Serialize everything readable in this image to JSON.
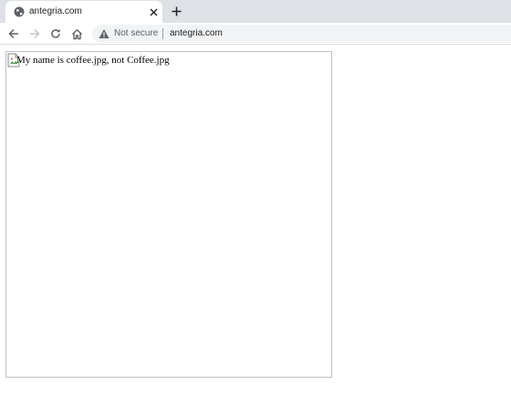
{
  "browser": {
    "tab": {
      "title": "antegria.com",
      "favicon": "globe-icon",
      "close_icon": "close-icon"
    },
    "new_tab_icon": "plus-icon",
    "toolbar": {
      "back_icon": "arrow-left-icon",
      "forward_icon": "arrow-right-icon",
      "reload_icon": "reload-icon",
      "home_icon": "home-icon"
    },
    "omnibox": {
      "security_icon": "warning-icon",
      "security_label": "Not secure",
      "url": "antegria.com"
    }
  },
  "page": {
    "image": {
      "alt": "My name is coffee.jpg, not Coffee.jpg",
      "state": "broken",
      "icon": "broken-image-icon"
    }
  },
  "colors": {
    "tabstrip_bg": "#dee1e6",
    "omnibox_bg": "#f1f3f4",
    "icon_gray": "#5f6368",
    "disabled_gray": "#9aa0a6"
  }
}
